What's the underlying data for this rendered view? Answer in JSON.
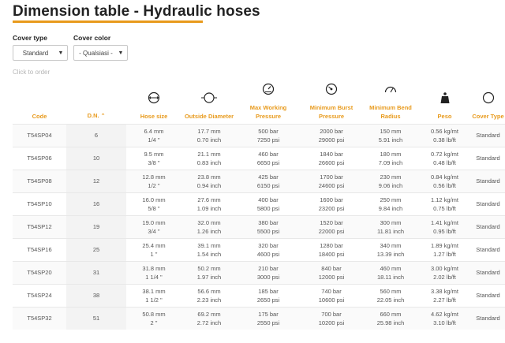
{
  "page": {
    "title": "Dimension table - Hydraulic hoses"
  },
  "colors": {
    "accent": "#e89a1c",
    "text": "#555555",
    "hint": "#b5b5b5"
  },
  "filters": {
    "cover_type": {
      "label": "Cover type",
      "value": "Standard"
    },
    "cover_color": {
      "label": "Cover color",
      "value": "- Qualsiasi -"
    },
    "hint": "Click to order"
  },
  "table": {
    "headers": {
      "code": "Code",
      "dn": "D.N.",
      "hose_size": "Hose size",
      "outside_diameter": "Outside Diameter",
      "max_working_pressure": [
        "Max Working",
        "Pressure"
      ],
      "min_burst_pressure": [
        "Minimum Burst",
        "Pressure"
      ],
      "min_bend_radius": [
        "Minimum Bend",
        "Radius"
      ],
      "peso": "Peso",
      "cover_type": "Cover Type"
    },
    "icons": {
      "hose_size": "hose-size-icon",
      "outside_diameter": "outside-diameter-icon",
      "max_working_pressure": "pressure-gauge-icon",
      "min_burst_pressure": "burst-pressure-icon",
      "min_bend_radius": "bend-radius-icon",
      "peso": "weight-icon",
      "cover_type": "cover-type-icon"
    },
    "rows": [
      {
        "code": "T54SP04",
        "dn": "6",
        "size_mm": "6.4 mm",
        "size_in": "1/4 \"",
        "od_mm": "17.7 mm",
        "od_in": "0.70 inch",
        "wp_bar": "500 bar",
        "wp_psi": "7250 psi",
        "bp_bar": "2000 bar",
        "bp_psi": "29000 psi",
        "br_mm": "150 mm",
        "br_in": "5.91 inch",
        "w_kg": "0.56 kg/mt",
        "w_lb": "0.38 lb/ft",
        "cover": "Standard"
      },
      {
        "code": "T54SP06",
        "dn": "10",
        "size_mm": "9.5 mm",
        "size_in": "3/8 \"",
        "od_mm": "21.1 mm",
        "od_in": "0.83 inch",
        "wp_bar": "460 bar",
        "wp_psi": "6650 psi",
        "bp_bar": "1840 bar",
        "bp_psi": "26600 psi",
        "br_mm": "180 mm",
        "br_in": "7.09 inch",
        "w_kg": "0.72 kg/mt",
        "w_lb": "0.48 lb/ft",
        "cover": "Standard"
      },
      {
        "code": "T54SP08",
        "dn": "12",
        "size_mm": "12.8 mm",
        "size_in": "1/2 \"",
        "od_mm": "23.8 mm",
        "od_in": "0.94 inch",
        "wp_bar": "425 bar",
        "wp_psi": "6150 psi",
        "bp_bar": "1700 bar",
        "bp_psi": "24600 psi",
        "br_mm": "230 mm",
        "br_in": "9.06 inch",
        "w_kg": "0.84 kg/mt",
        "w_lb": "0.56 lb/ft",
        "cover": "Standard"
      },
      {
        "code": "T54SP10",
        "dn": "16",
        "size_mm": "16.0 mm",
        "size_in": "5/8 \"",
        "od_mm": "27.6 mm",
        "od_in": "1.09 inch",
        "wp_bar": "400 bar",
        "wp_psi": "5800 psi",
        "bp_bar": "1600 bar",
        "bp_psi": "23200 psi",
        "br_mm": "250 mm",
        "br_in": "9.84 inch",
        "w_kg": "1.12 kg/mt",
        "w_lb": "0.75 lb/ft",
        "cover": "Standard"
      },
      {
        "code": "T54SP12",
        "dn": "19",
        "size_mm": "19.0 mm",
        "size_in": "3/4 \"",
        "od_mm": "32.0 mm",
        "od_in": "1.26 inch",
        "wp_bar": "380 bar",
        "wp_psi": "5500 psi",
        "bp_bar": "1520 bar",
        "bp_psi": "22000 psi",
        "br_mm": "300 mm",
        "br_in": "11.81 inch",
        "w_kg": "1.41 kg/mt",
        "w_lb": "0.95 lb/ft",
        "cover": "Standard"
      },
      {
        "code": "T54SP16",
        "dn": "25",
        "size_mm": "25.4 mm",
        "size_in": "1 \"",
        "od_mm": "39.1 mm",
        "od_in": "1.54 inch",
        "wp_bar": "320 bar",
        "wp_psi": "4600 psi",
        "bp_bar": "1280 bar",
        "bp_psi": "18400 psi",
        "br_mm": "340 mm",
        "br_in": "13.39 inch",
        "w_kg": "1.89 kg/mt",
        "w_lb": "1.27 lb/ft",
        "cover": "Standard"
      },
      {
        "code": "T54SP20",
        "dn": "31",
        "size_mm": "31.8 mm",
        "size_in": "1 1/4 \"",
        "od_mm": "50.2 mm",
        "od_in": "1.97 inch",
        "wp_bar": "210 bar",
        "wp_psi": "3000 psi",
        "bp_bar": "840 bar",
        "bp_psi": "12000 psi",
        "br_mm": "460 mm",
        "br_in": "18.11 inch",
        "w_kg": "3.00 kg/mt",
        "w_lb": "2.02 lb/ft",
        "cover": "Standard"
      },
      {
        "code": "T54SP24",
        "dn": "38",
        "size_mm": "38.1 mm",
        "size_in": "1 1/2 \"",
        "od_mm": "56.6 mm",
        "od_in": "2.23 inch",
        "wp_bar": "185 bar",
        "wp_psi": "2650 psi",
        "bp_bar": "740 bar",
        "bp_psi": "10600 psi",
        "br_mm": "560 mm",
        "br_in": "22.05 inch",
        "w_kg": "3.38 kg/mt",
        "w_lb": "2.27 lb/ft",
        "cover": "Standard"
      },
      {
        "code": "T54SP32",
        "dn": "51",
        "size_mm": "50.8 mm",
        "size_in": "2 \"",
        "od_mm": "69.2 mm",
        "od_in": "2.72 inch",
        "wp_bar": "175 bar",
        "wp_psi": "2550 psi",
        "bp_bar": "700 bar",
        "bp_psi": "10200 psi",
        "br_mm": "660 mm",
        "br_in": "25.98 inch",
        "w_kg": "4.62 kg/mt",
        "w_lb": "3.10 lb/ft",
        "cover": "Standard"
      }
    ]
  }
}
